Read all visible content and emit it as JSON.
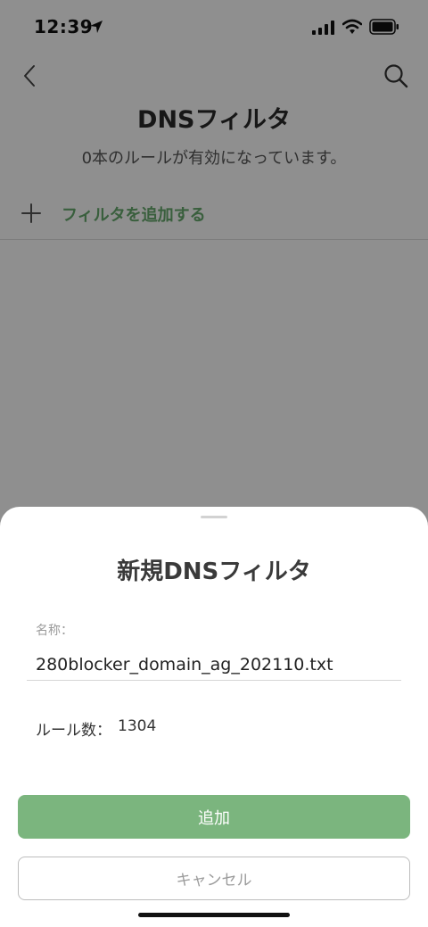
{
  "status_bar": {
    "time": "12:39"
  },
  "nav": {
    "title": "DNSフィルタ",
    "subtitle": "0本のルールが有効になっています。"
  },
  "add_filter": {
    "label": "フィルタを追加する"
  },
  "sheet": {
    "title": "新規DNSフィルタ",
    "name_label": "名称：",
    "name_value": "280blocker_domain_ag_202110.txt",
    "rules_label": "ルール数：",
    "rules_value": "1304",
    "add_button": "追加",
    "cancel_button": "キャンセル"
  },
  "colors": {
    "accent": "#67a96d",
    "add_button": "#7bb57e"
  },
  "icons": [
    "location-arrow-icon",
    "cellular-signal-icon",
    "wifi-icon",
    "battery-icon",
    "chevron-left-icon",
    "search-icon",
    "plus-icon"
  ]
}
